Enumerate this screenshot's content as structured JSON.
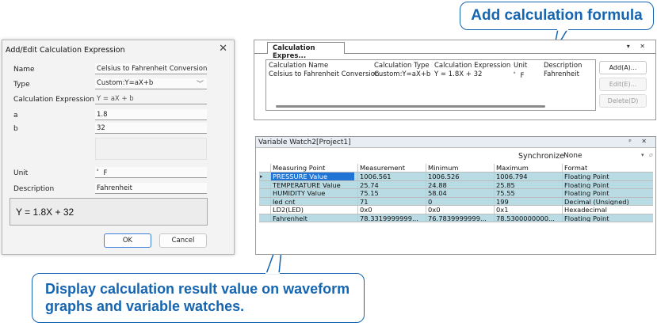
{
  "callouts": {
    "top": "Add calculation formula",
    "bottom_line1": "Display calculation result value on waveform",
    "bottom_line2": "graphs and variable watches."
  },
  "dialog": {
    "title": "Add/Edit Calculation Expression",
    "close_glyph": "✕",
    "labels": {
      "name": "Name",
      "type": "Type",
      "expression": "Calculation Expression",
      "a": "a",
      "b": "b",
      "unit": "Unit",
      "description": "Description"
    },
    "values": {
      "name": "Celsius to Fahrenheit Conversion",
      "type": "Custom:Y=aX+b",
      "expression": "Y = aX + b",
      "a": "1.8",
      "b": "32",
      "unit": "゜F",
      "description": "Fahrenheit"
    },
    "formula_display": "Y = 1.8X + 32",
    "ok_label": "OK",
    "cancel_label": "Cancel"
  },
  "calc_panel": {
    "tab_label": "Calculation Expres...",
    "controls": "▾ ✕",
    "columns": [
      "Calculation Name",
      "Calculation Type",
      "Calculation Expression",
      "Unit",
      "Description"
    ],
    "row": [
      "Celsius to Fahrenheit Conversion",
      "Custom:Y=aX+b",
      "Y = 1.8X + 32",
      "゜F",
      "Fahrenheit"
    ],
    "buttons": {
      "add": "Add(A)...",
      "edit": "Edit(E)...",
      "delete": "Delete(D)"
    }
  },
  "watch": {
    "title": "Variable Watch2[Project1]",
    "controls": "ᵖ ✕",
    "sync_label": "Synchronize",
    "sync_value": "None",
    "sync_chevron": "▾",
    "pin_glyph": "⌀",
    "columns": [
      "Measuring Point",
      "Measurement",
      "Minimum",
      "Maximum",
      "Format"
    ],
    "rows": [
      [
        "PRESSURE Value",
        "1006.561",
        "1006.526",
        "1006.794",
        "Floating Point"
      ],
      [
        "TEMPERATURE Value",
        "25.74",
        "24.88",
        "25.85",
        "Floating Point"
      ],
      [
        "HUMIDITY Value",
        "75.15",
        "58.04",
        "75.55",
        "Floating Point"
      ],
      [
        "led cnt",
        "71",
        "0",
        "199",
        "Decimal (Unsigned)"
      ],
      [
        "LD2(LED)",
        "0x0",
        "0x0",
        "0x1",
        "Hexadecimal"
      ],
      [
        "Fahrenheit",
        "78.3319999999...",
        "76.7839999999...",
        "78.5300000000...",
        "Floating Point"
      ]
    ],
    "highlighted_rows": [
      0,
      1,
      2,
      3,
      5
    ]
  },
  "colors": {
    "accent": "#1565b0",
    "row_highlight": "#b9dbe4",
    "selection": "#1f74d6"
  }
}
